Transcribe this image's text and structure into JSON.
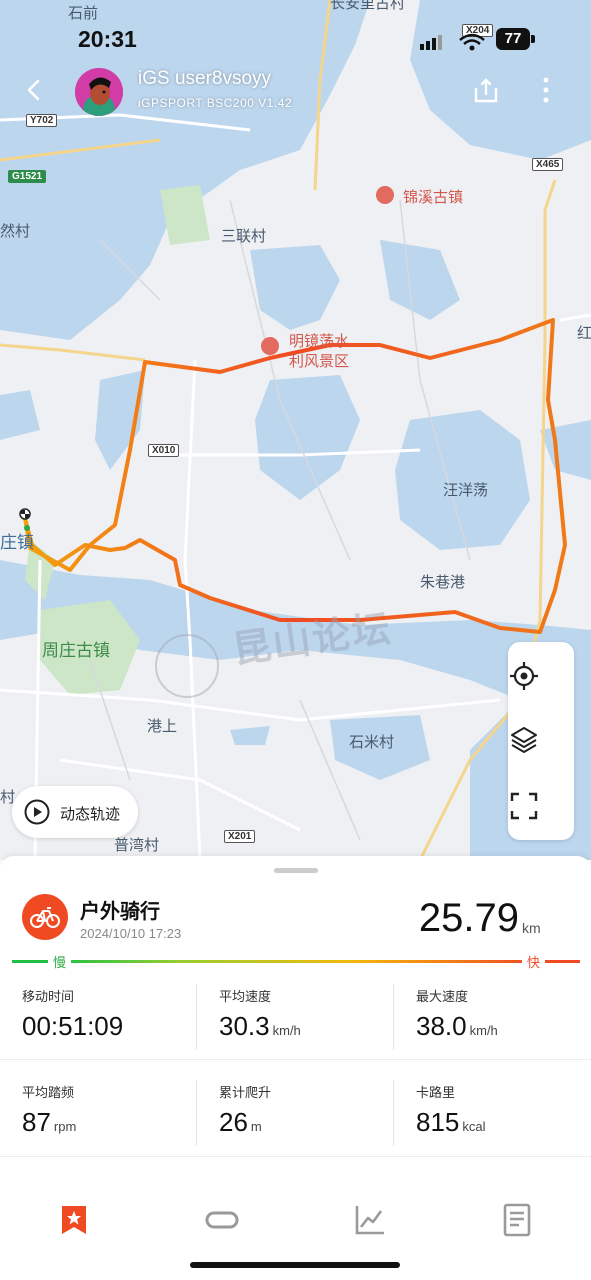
{
  "status_bar": {
    "time": "20:31",
    "battery": "77"
  },
  "header": {
    "username": "iGS user8vsoyy",
    "device": "iGPSPORT BSC200 V1.42"
  },
  "map": {
    "labels": {
      "shiqian": "石前",
      "top_place": "长安里古村",
      "sanlian": "三联村",
      "jinxi": "锦溪古镇",
      "mingjing": "明镜荡水",
      "lifeng": "利风景区",
      "wangyang": "汪洋荡",
      "zhuxiang": "朱巷港",
      "zhouzhuang_guzhen": "周庄古镇",
      "zhuang_town": "庄镇",
      "gangshang": "港上",
      "shimi": "石米村",
      "puwan": "普湾村",
      "ran": "然村",
      "hong": "红",
      "cheng": "村"
    },
    "roads": {
      "y702": "Y702",
      "g1521": "G1521",
      "x204": "X204",
      "x465": "X465",
      "x010": "X010",
      "x201": "X201"
    },
    "watermark": "昆山论坛",
    "replay_label": "动态轨迹"
  },
  "activity": {
    "type": "户外骑行",
    "datetime": "2024/10/10 17:23",
    "distance": "25.79",
    "distance_unit": "km",
    "slow_label": "慢",
    "fast_label": "快"
  },
  "stats": {
    "moving_time": {
      "label": "移动时间",
      "value": "00:51:09",
      "unit": ""
    },
    "avg_speed": {
      "label": "平均速度",
      "value": "30.3",
      "unit": "km/h"
    },
    "max_speed": {
      "label": "最大速度",
      "value": "38.0",
      "unit": "km/h"
    },
    "avg_cadence": {
      "label": "平均踏频",
      "value": "87",
      "unit": "rpm"
    },
    "elevation": {
      "label": "累计爬升",
      "value": "26",
      "unit": "m"
    },
    "calories": {
      "label": "卡路里",
      "value": "815",
      "unit": "kcal"
    }
  },
  "colors": {
    "accent": "#f04a23",
    "slow": "#2aa845",
    "water": "#bcd6ee"
  }
}
